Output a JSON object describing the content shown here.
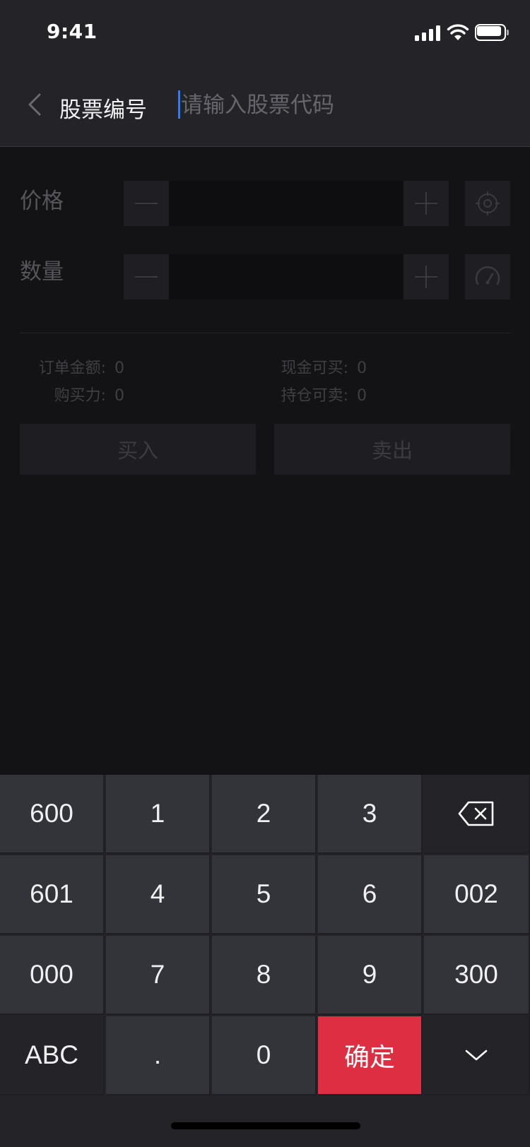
{
  "status_bar": {
    "time": "9:41"
  },
  "nav": {
    "title": "股票编号",
    "search_placeholder": "请输入股票代码",
    "search_value": ""
  },
  "form": {
    "price_label": "价格",
    "price_value": "",
    "quantity_label": "数量",
    "quantity_value": ""
  },
  "summary": {
    "order_amount_label": "订单金额:",
    "order_amount_value": "0",
    "buying_power_label": "购买力:",
    "buying_power_value": "0",
    "cash_buyable_label": "现金可买:",
    "cash_buyable_value": "0",
    "position_sellable_label": "持仓可卖:",
    "position_sellable_value": "0"
  },
  "actions": {
    "buy_label": "买入",
    "sell_label": "卖出"
  },
  "keyboard": {
    "rows": [
      [
        "600",
        "1",
        "2",
        "3",
        "backspace"
      ],
      [
        "601",
        "4",
        "5",
        "6",
        "002"
      ],
      [
        "000",
        "7",
        "8",
        "9",
        "300"
      ],
      [
        "ABC",
        ".",
        "0",
        "确定",
        "hide"
      ]
    ],
    "labels": {
      "k600": "600",
      "k1": "1",
      "k2": "2",
      "k3": "3",
      "k601": "601",
      "k4": "4",
      "k5": "5",
      "k6": "6",
      "k002": "002",
      "k000": "000",
      "k7": "7",
      "k8": "8",
      "k9": "9",
      "k300": "300",
      "abc": "ABC",
      "dot": ".",
      "k0": "0",
      "confirm": "确定"
    },
    "icons": {
      "backspace": "backspace-icon",
      "hide": "chevron-down-icon"
    }
  },
  "colors": {
    "accent_red": "#de2e42",
    "caret_blue": "#2f7cf6",
    "nav_bg": "#232328",
    "content_bg": "#131315",
    "key_bg": "#33333a"
  }
}
